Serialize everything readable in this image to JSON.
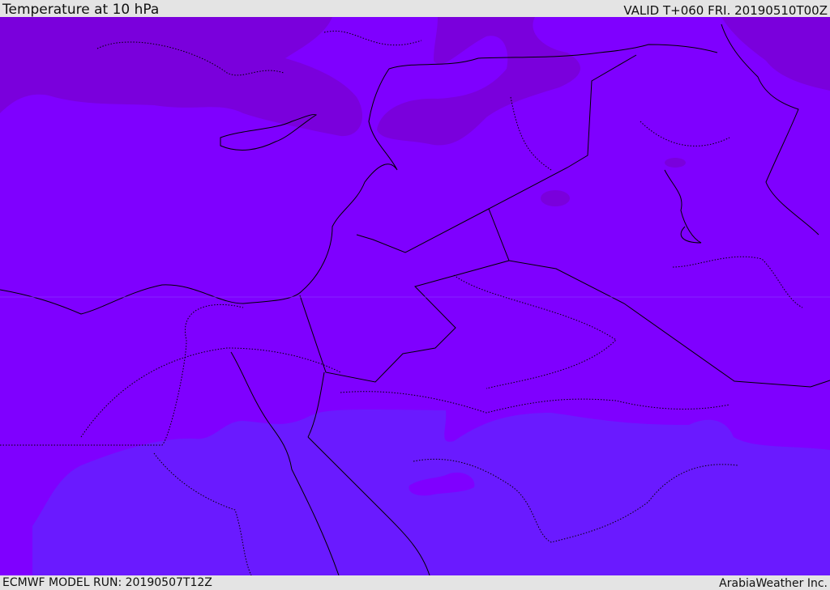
{
  "header": {
    "title": "Temperature at 10 hPa",
    "valid": "VALID T+060 FRI. 20190510T00Z"
  },
  "footer": {
    "model_run": "ECMWF MODEL RUN: 20190507T12Z",
    "brand": "ArabiaWeather Inc."
  },
  "colors": {
    "base": "#7f00ff",
    "warm": "#7a00dc",
    "cool": "#6a1aff"
  }
}
